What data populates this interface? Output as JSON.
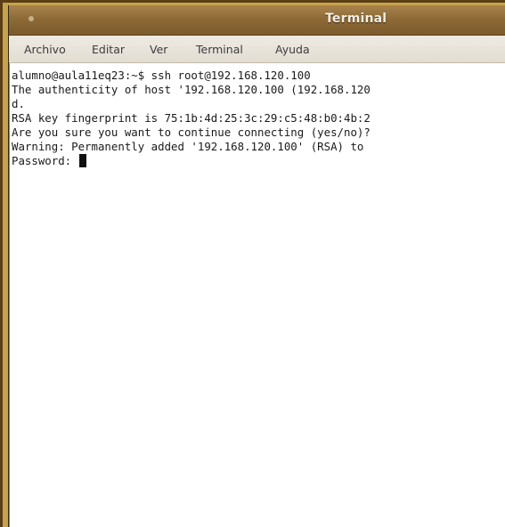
{
  "window": {
    "title": "Terminal"
  },
  "menu": {
    "items": [
      "Archivo",
      "Editar",
      "Ver",
      "Terminal",
      "Ayuda"
    ]
  },
  "terminal": {
    "lines": [
      "alumno@aula11eq23:~$ ssh root@192.168.120.100",
      "The authenticity of host '192.168.120.100 (192.168.120",
      "d.",
      "RSA key fingerprint is 75:1b:4d:25:3c:29:c5:48:b0:4b:2",
      "Are you sure you want to continue connecting (yes/no)?",
      "Warning: Permanently added '192.168.120.100' (RSA) to",
      "Password: "
    ]
  },
  "colors": {
    "titlebar": "#8e6a37",
    "frame": "#c9a34a",
    "terminal_background": "#ffffff",
    "terminal_text": "#1a1a1a"
  }
}
